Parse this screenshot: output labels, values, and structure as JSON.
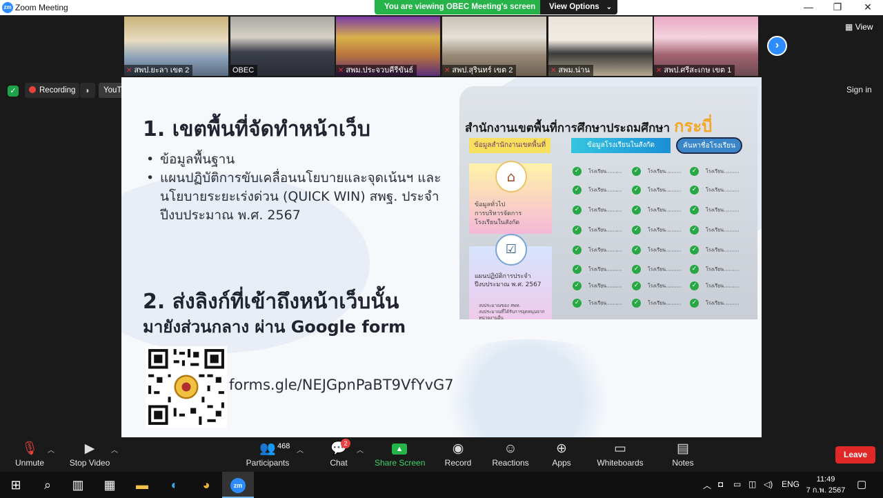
{
  "window": {
    "title": "Zoom Meeting",
    "app_icon": "zm"
  },
  "share_banner": {
    "message": "You are viewing OBEC Meeting's screen",
    "view_options": "View Options"
  },
  "gallery": {
    "tiles": [
      {
        "name": "สพป.ยะลา เขต 2",
        "muted": true
      },
      {
        "name": "OBEC",
        "muted": false
      },
      {
        "name": "สพม.ประจวบคีรีขันธ์",
        "muted": true
      },
      {
        "name": "สพป.สุรินทร์ เขต 2",
        "muted": true
      },
      {
        "name": "สพม.น่าน",
        "muted": true
      },
      {
        "name": "สพป.ศรีสะเกษ เขต 1",
        "muted": true
      }
    ],
    "view_label": "View"
  },
  "meeting_bar": {
    "recording_label": "Recording",
    "youtube_label": "YouTube",
    "sign_in": "Sign in"
  },
  "slide": {
    "heading1": "1. เขตพื้นที่จัดทำหน้าเว็บ",
    "bullets": [
      "ข้อมูลพื้นฐาน",
      "แผนปฏิบัติการขับเคลื่อนนโยบายและจุดเน้นฯ และนโยบายระยะเร่งด่วน (QUICK WIN) สพฐ. ประจำปีงบประมาณ พ.ศ. 2567"
    ],
    "heading2": "2. ส่งลิงก์ที่เข้าถึงหน้าเว็บนั้น",
    "heading3": "มายังส่วนกลาง ผ่าน Google form",
    "link": "forms.gle/NEJGpnPaBT9VfYvG7",
    "preview": {
      "title": "สำนักงานเขตพื้นที่การศึกษาประถมศึกษา",
      "title_accent": "กระบี่",
      "label_office": "ข้อมูลสำนักงานเขตพื้นที่",
      "label_schools": "ข้อมูลโรงเรียนในสังกัด",
      "search_button": "ค้นหาชื่อโรงเรียน",
      "card1_items": [
        "ข้อมูลทั่วไป",
        "การบริหารจัดการโรงเรียนในสังกัด"
      ],
      "card2_title": "แผนปฏิบัติการประจำปีงบประมาณ พ.ศ. 2567",
      "card2_items": [
        "งบประมาณของ สพท.",
        "งบประมาณที่ได้รับการอุดหนุนจากหน่วยงานอื่น"
      ],
      "school_placeholder": "โรงเรียน.........."
    }
  },
  "toolbar": {
    "unmute": "Unmute",
    "stop_video": "Stop Video",
    "participants": "Participants",
    "participants_count": "468",
    "chat": "Chat",
    "chat_badge": "2",
    "share_screen": "Share Screen",
    "record": "Record",
    "reactions": "Reactions",
    "apps": "Apps",
    "whiteboards": "Whiteboards",
    "notes": "Notes",
    "leave": "Leave"
  },
  "taskbar": {
    "time": "11:49",
    "date": "7 ก.พ. 2567",
    "language": "ENG"
  },
  "colors": {
    "zoom_blue": "#2d8cff",
    "share_green": "#26b34a",
    "leave_red": "#e02828"
  }
}
